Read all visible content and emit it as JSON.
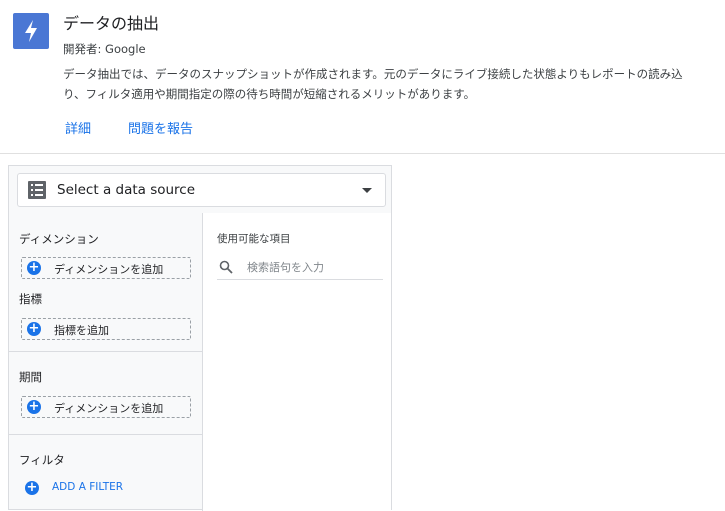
{
  "header": {
    "icon": "lightning-bolt-icon",
    "accent_color": "#4a77d4",
    "title": "データの抽出",
    "developer": "開発者: Google",
    "description_lines": [
      "データ抽出では、データのスナップショットが作成されます。元のデータにライブ接続した状態よりもレポートの読み込",
      "り、フィルタ適用や期間指定の際の待ち時間が短縮されるメリットがあります。"
    ],
    "links": {
      "details": "詳細",
      "report_issue": "問題を報告"
    }
  },
  "data_source": {
    "label": "Select a data source",
    "icon": "table-icon"
  },
  "sections": {
    "dimension": {
      "label": "ディメンション",
      "add": "ディメンションを追加"
    },
    "metric": {
      "label": "指標",
      "add": "指標を追加"
    },
    "date_range": {
      "label": "期間",
      "add": "ディメンションを追加"
    },
    "filter": {
      "label": "フィルタ",
      "add": "ADD A FILTER"
    }
  },
  "available_fields": {
    "title": "使用可能な項目",
    "search_placeholder": "検索語句を入力"
  }
}
